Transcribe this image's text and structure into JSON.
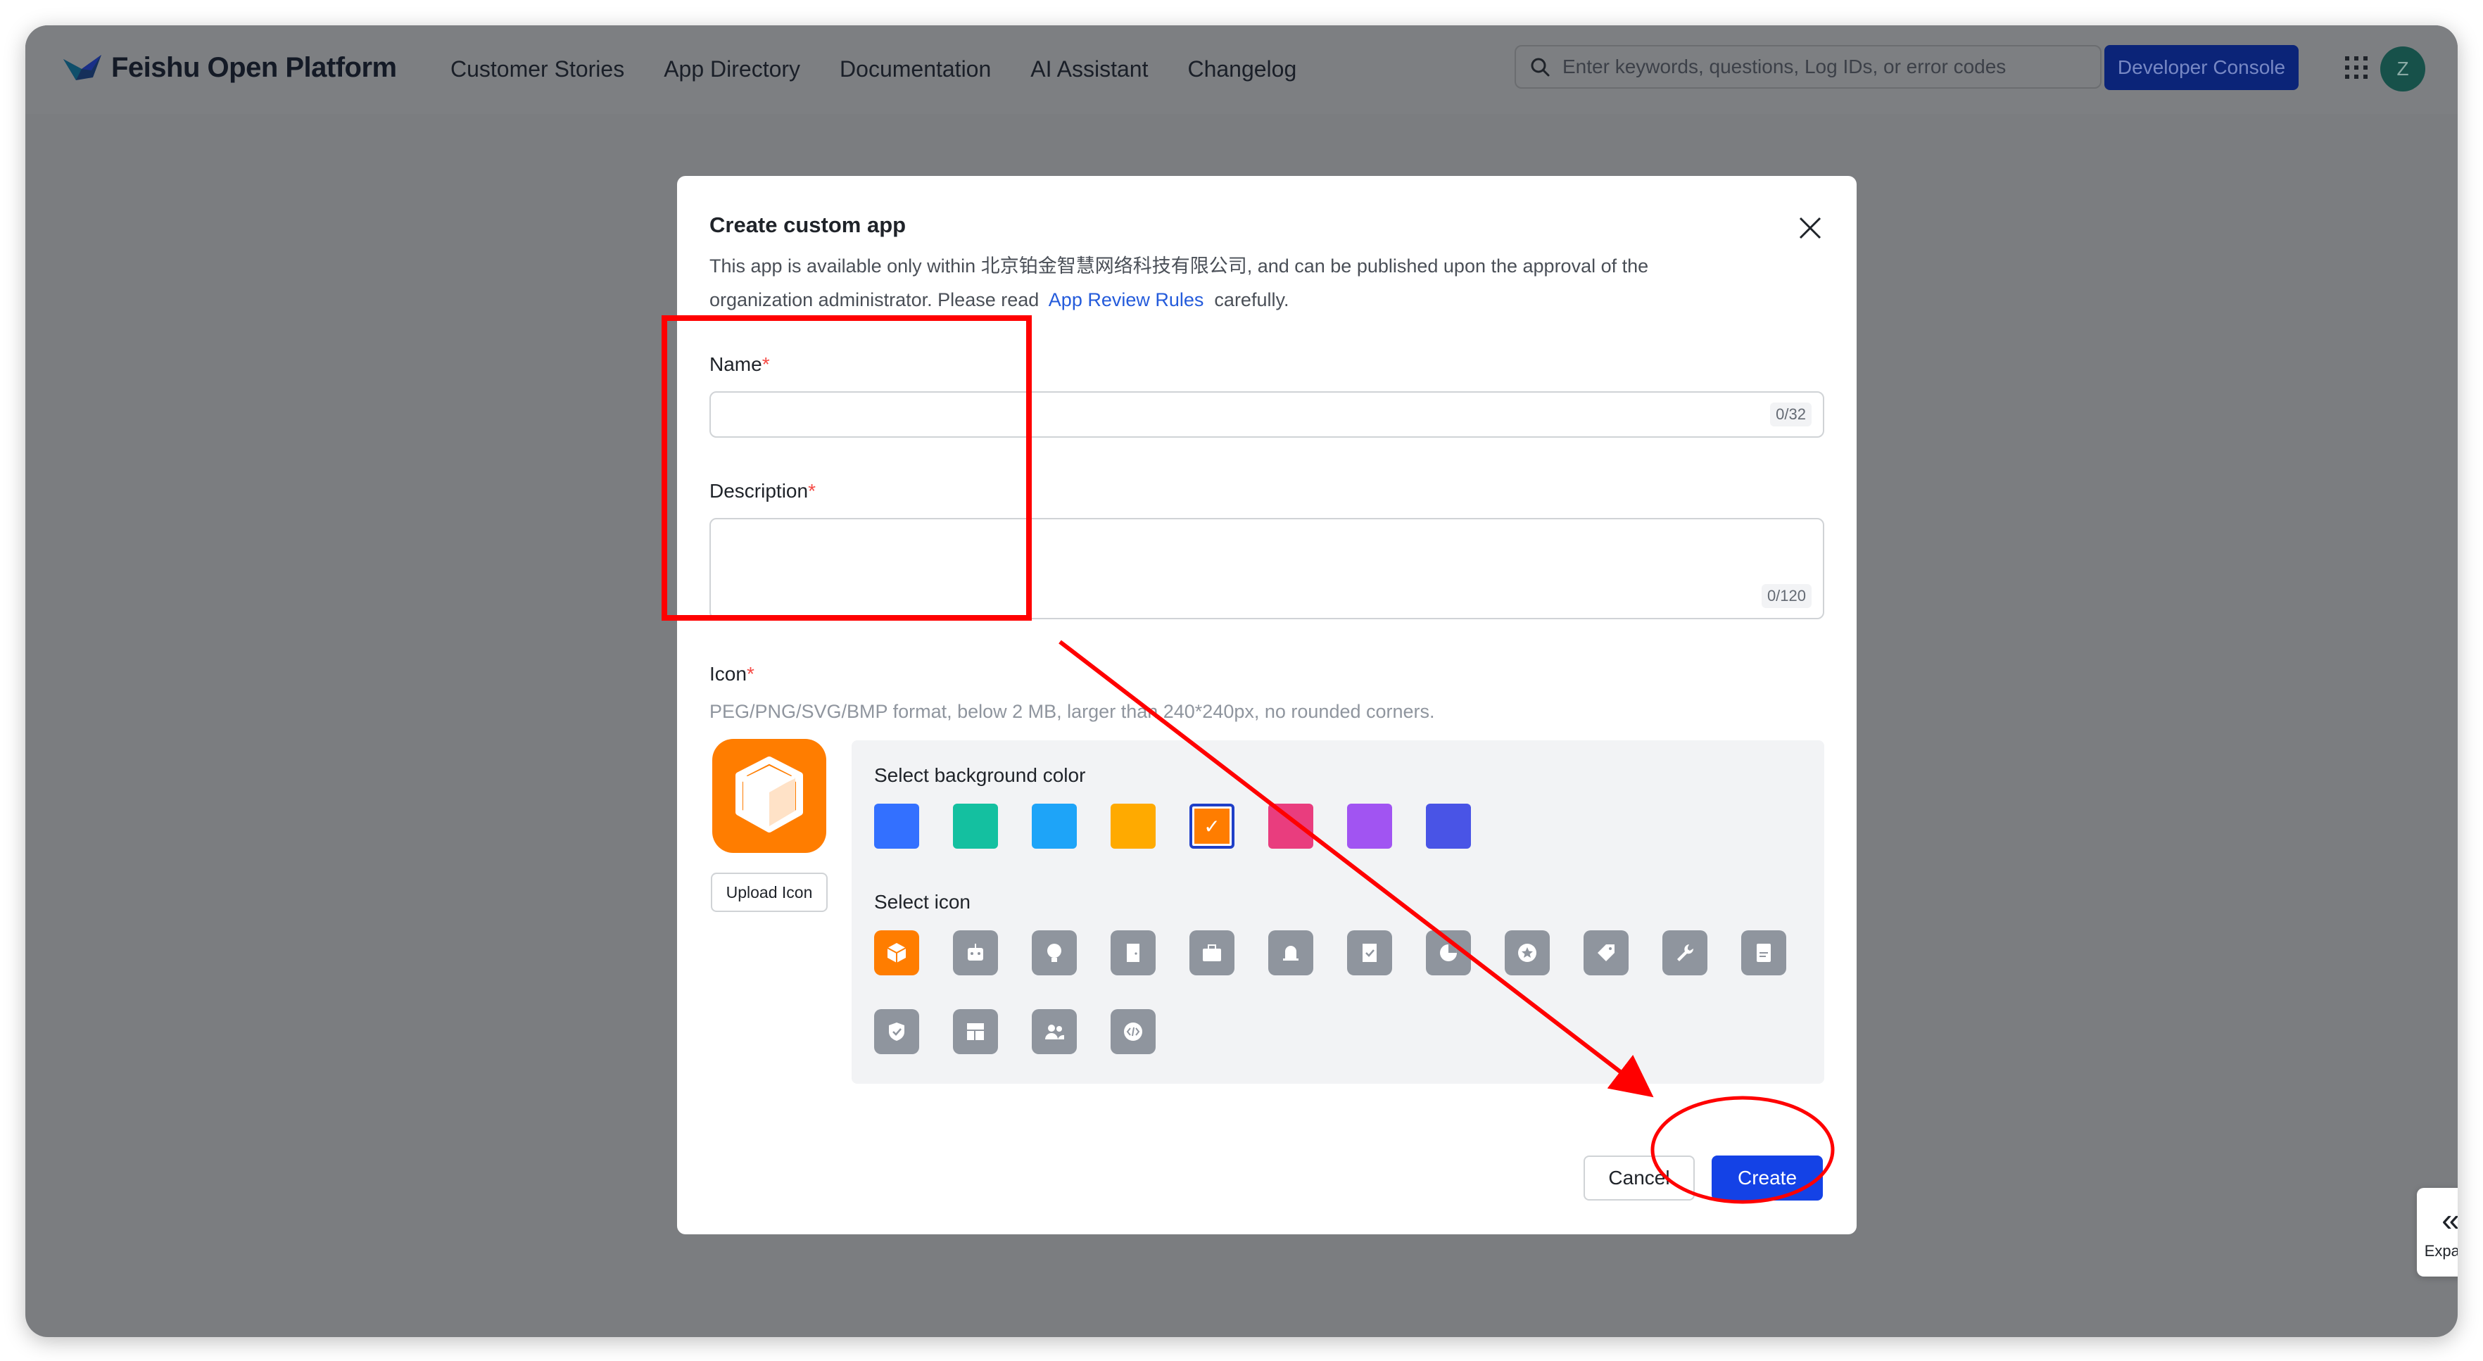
{
  "nav": {
    "logo_text": "Feishu Open Platform",
    "links": [
      "Customer Stories",
      "App Directory",
      "Documentation",
      "AI Assistant",
      "Changelog"
    ],
    "search_placeholder": "Enter keywords, questions, Log IDs, or error codes",
    "console_label": "Developer Console",
    "avatar_letter": "Z"
  },
  "modal": {
    "title": "Create custom app",
    "intro_line1": "This app is available only within 北京铂金智慧网络科技有限公司, and can be published upon the approval of the",
    "intro_line2_prefix": "organization administrator. Please read",
    "intro_link": "App Review Rules",
    "intro_line2_suffix": "carefully.",
    "name_label": "Name",
    "name_value": "",
    "name_counter": "0/32",
    "description_label": "Description",
    "description_value": "",
    "description_counter": "0/120",
    "icon_label": "Icon",
    "required_mark": "*",
    "icon_hint": "PEG/PNG/SVG/BMP format, below 2 MB, larger than 240*240px, no rounded corners.",
    "upload_label": "Upload Icon",
    "bg_color_label": "Select background color",
    "bg_colors": [
      "#3370ff",
      "#14c0a0",
      "#1ea4f8",
      "#ffaa00",
      "#ff7d00",
      "#e93d7e",
      "#a154f2",
      "#4954e6"
    ],
    "selected_bg_color_index": 4,
    "select_icon_label": "Select icon",
    "icons": [
      "cube-icon",
      "robot-icon",
      "lightbulb-icon",
      "door-icon",
      "briefcase-icon",
      "bell-icon",
      "bookmark-check-icon",
      "pie-chart-icon",
      "star-badge-icon",
      "tag-icon",
      "wrench-icon",
      "document-icon",
      "shield-check-icon",
      "layout-icon",
      "people-icon",
      "code-icon"
    ],
    "selected_icon_index": 0,
    "cancel_label": "Cancel",
    "create_label": "Create",
    "colors": {
      "primary": "#1442e6",
      "link": "#245bdb",
      "required": "#f54a45",
      "accent": "#ff7d00",
      "annotation": "#ff0000"
    }
  },
  "side_panel": {
    "expand_label": "Expand"
  }
}
